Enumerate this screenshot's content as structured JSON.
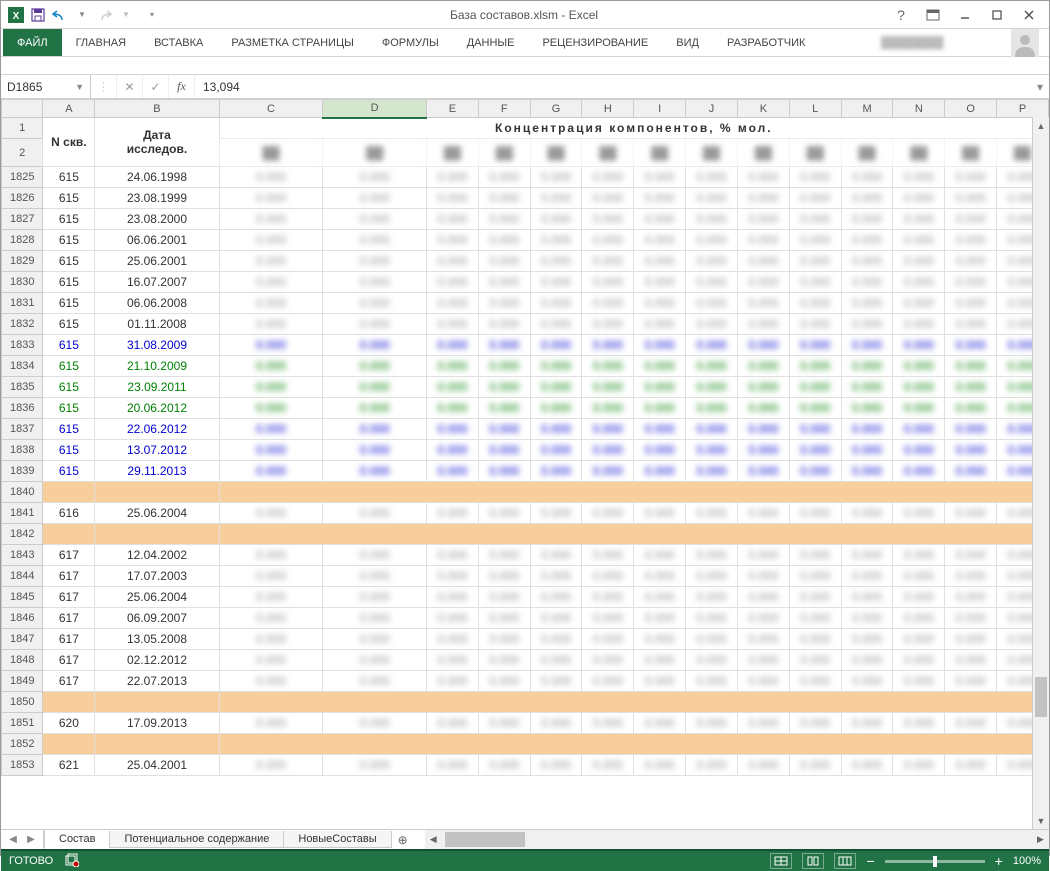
{
  "title": "База составов.xlsm - Excel",
  "qat": {
    "save": "save",
    "undo": "undo",
    "redo": "redo"
  },
  "ribbon": {
    "file": "ФАЙЛ",
    "tabs": [
      "ГЛАВНАЯ",
      "ВСТАВКА",
      "РАЗМЕТКА СТРАНИЦЫ",
      "ФОРМУЛЫ",
      "ДАННЫЕ",
      "РЕЦЕНЗИРОВАНИЕ",
      "ВИД",
      "РАЗРАБОТЧИК"
    ]
  },
  "formula_bar": {
    "name_box": "D1865",
    "value": "13,094"
  },
  "columns": [
    "",
    "A",
    "B",
    "C",
    "D",
    "E",
    "F",
    "G",
    "H",
    "I",
    "J",
    "K",
    "L",
    "M",
    "N",
    "O",
    "P"
  ],
  "selected_col": "D",
  "header1": {
    "a": "N скв.",
    "b": "Дата исследов.",
    "merged": "Концентрация компонентов, % мол."
  },
  "rows": [
    {
      "num": "1",
      "type": "head1"
    },
    {
      "num": "2",
      "type": "head2"
    },
    {
      "num": "1825",
      "a": "615",
      "b": "24.06.1998",
      "style": ""
    },
    {
      "num": "1826",
      "a": "615",
      "b": "23.08.1999",
      "style": ""
    },
    {
      "num": "1827",
      "a": "615",
      "b": "23.08.2000",
      "style": ""
    },
    {
      "num": "1828",
      "a": "615",
      "b": "06.06.2001",
      "style": ""
    },
    {
      "num": "1829",
      "a": "615",
      "b": "25.06.2001",
      "style": ""
    },
    {
      "num": "1830",
      "a": "615",
      "b": "16.07.2007",
      "style": ""
    },
    {
      "num": "1831",
      "a": "615",
      "b": "06.06.2008",
      "style": ""
    },
    {
      "num": "1832",
      "a": "615",
      "b": "01.11.2008",
      "style": ""
    },
    {
      "num": "1833",
      "a": "615",
      "b": "31.08.2009",
      "style": "blue-row"
    },
    {
      "num": "1834",
      "a": "615",
      "b": "21.10.2009",
      "style": "green-row"
    },
    {
      "num": "1835",
      "a": "615",
      "b": "23.09.2011",
      "style": "green-row"
    },
    {
      "num": "1836",
      "a": "615",
      "b": "20.06.2012",
      "style": "green-row"
    },
    {
      "num": "1837",
      "a": "615",
      "b": "22.06.2012",
      "style": "blue-row"
    },
    {
      "num": "1838",
      "a": "615",
      "b": "13.07.2012",
      "style": "blue-row"
    },
    {
      "num": "1839",
      "a": "615",
      "b": "29.11.2013",
      "style": "blue-row"
    },
    {
      "num": "1840",
      "a": "",
      "b": "",
      "style": "orange"
    },
    {
      "num": "1841",
      "a": "616",
      "b": "25.06.2004",
      "style": ""
    },
    {
      "num": "1842",
      "a": "",
      "b": "",
      "style": "orange"
    },
    {
      "num": "1843",
      "a": "617",
      "b": "12.04.2002",
      "style": ""
    },
    {
      "num": "1844",
      "a": "617",
      "b": "17.07.2003",
      "style": ""
    },
    {
      "num": "1845",
      "a": "617",
      "b": "25.06.2004",
      "style": ""
    },
    {
      "num": "1846",
      "a": "617",
      "b": "06.09.2007",
      "style": ""
    },
    {
      "num": "1847",
      "a": "617",
      "b": "13.05.2008",
      "style": ""
    },
    {
      "num": "1848",
      "a": "617",
      "b": "02.12.2012",
      "style": ""
    },
    {
      "num": "1849",
      "a": "617",
      "b": "22.07.2013",
      "style": ""
    },
    {
      "num": "1850",
      "a": "",
      "b": "",
      "style": "orange"
    },
    {
      "num": "1851",
      "a": "620",
      "b": "17.09.2013",
      "style": ""
    },
    {
      "num": "1852",
      "a": "",
      "b": "",
      "style": "orange"
    },
    {
      "num": "1853",
      "a": "621",
      "b": "25.04.2001",
      "style": "cut"
    }
  ],
  "sheet_tabs": {
    "active": "Состав",
    "others": [
      "Потенциальное содержание",
      "НовыеСоставы"
    ]
  },
  "status": {
    "ready": "ГОТОВО",
    "zoom": "100%"
  }
}
